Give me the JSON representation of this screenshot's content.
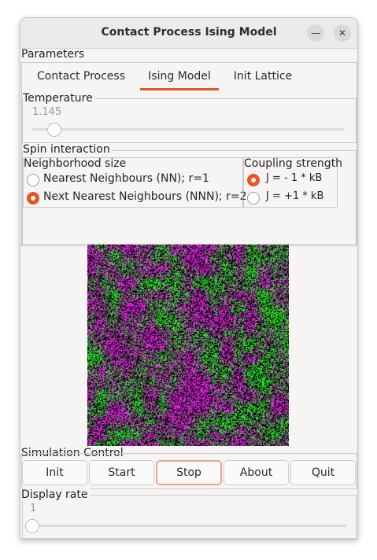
{
  "window": {
    "title": "Contact Process Ising Model",
    "minimize_glyph": "—",
    "close_glyph": "✕"
  },
  "parameters": {
    "label": "Parameters",
    "tabs": [
      {
        "label": "Contact Process"
      },
      {
        "label": "Ising Model",
        "selected": true
      },
      {
        "label": "Init Lattice"
      }
    ]
  },
  "temperature": {
    "label": "Temperature",
    "value": "1.145",
    "slider_fraction": 0.05
  },
  "spin_interaction": {
    "label": "Spin interaction",
    "neighborhood": {
      "label": "Neighborhood size",
      "options": [
        {
          "label": "Nearest Neighbours (NN); r=1",
          "selected": false
        },
        {
          "label": "Next Nearest Neighbours (NNN); r=2",
          "selected": true
        }
      ]
    },
    "coupling": {
      "label": "Coupling strength",
      "options": [
        {
          "label": "J = - 1 * kB",
          "selected": true
        },
        {
          "label": "J = +1 * kB",
          "selected": false
        }
      ]
    }
  },
  "lattice": {
    "colors": {
      "spin_up": "#e020e0",
      "spin_down": "#22ee22",
      "background": "#000000"
    }
  },
  "simulation_control": {
    "label": "Simulation Control",
    "buttons": [
      {
        "label": "Init"
      },
      {
        "label": "Start"
      },
      {
        "label": "Stop",
        "focused": true
      },
      {
        "label": "About"
      },
      {
        "label": "Quit"
      }
    ]
  },
  "display_rate": {
    "label": "Display rate",
    "value": "1",
    "slider_fraction": 0.0
  },
  "colors": {
    "accent": "#e95420"
  }
}
